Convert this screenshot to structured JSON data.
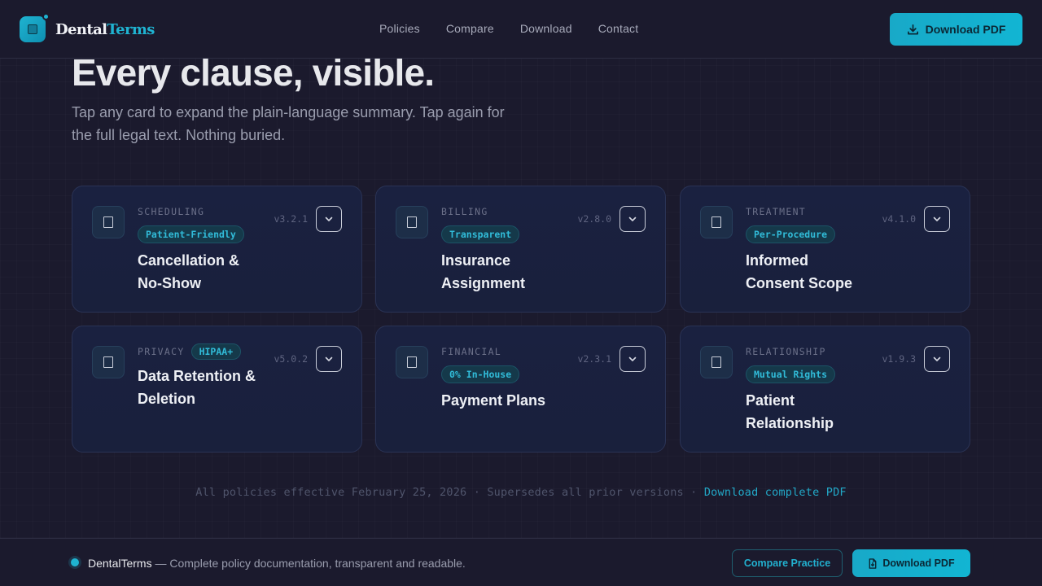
{
  "header": {
    "logo_part1": "Dental",
    "logo_part2": "Terms",
    "nav": [
      "Policies",
      "Compare",
      "Download",
      "Contact"
    ],
    "download_button": "Download PDF"
  },
  "hero": {
    "title": "Every clause, visible.",
    "subtitle": "Tap any card to expand the plain-language summary. Tap again for the full legal text. Nothing buried."
  },
  "cards": [
    {
      "category": "SCHEDULING",
      "badge": "Patient-Friendly",
      "title_line1": "Cancellation &",
      "title_line2": "No-Show",
      "version": "v3.2.1",
      "icon": "document-icon"
    },
    {
      "category": "BILLING",
      "badge": "Transparent",
      "title_line1": "Insurance",
      "title_line2": "Assignment",
      "version": "v2.8.0",
      "icon": "document-icon"
    },
    {
      "category": "TREATMENT",
      "badge": "Per-Procedure",
      "title_line1": "Informed",
      "title_line2": "Consent Scope",
      "version": "v4.1.0",
      "icon": "document-icon"
    },
    {
      "category": "PRIVACY",
      "badge": "HIPAA+",
      "title_line1": "Data Retention &",
      "title_line2": "Deletion",
      "version": "v5.0.2",
      "icon": "document-icon"
    },
    {
      "category": "FINANCIAL",
      "badge": "0% In-House",
      "title_line1": "Payment Plans",
      "title_line2": "",
      "version": "v2.3.1",
      "icon": "document-icon"
    },
    {
      "category": "RELATIONSHIP",
      "badge": "Mutual Rights",
      "title_line1": "Patient",
      "title_line2": "Relationship",
      "version": "v1.9.3",
      "icon": "document-icon"
    }
  ],
  "note": {
    "text": "All policies effective February 25, 2026 · Supersedes all prior versions · ",
    "link": "Download complete PDF"
  },
  "bottom_bar": {
    "brand": "DentalTerms",
    "description": " — Complete policy documentation, transparent and readable.",
    "compare_button": "Compare Practice",
    "download_button": "Download PDF"
  },
  "colors": {
    "accent": "#1fb3d1",
    "background": "#1b1a2d",
    "card": "#1a2140"
  }
}
